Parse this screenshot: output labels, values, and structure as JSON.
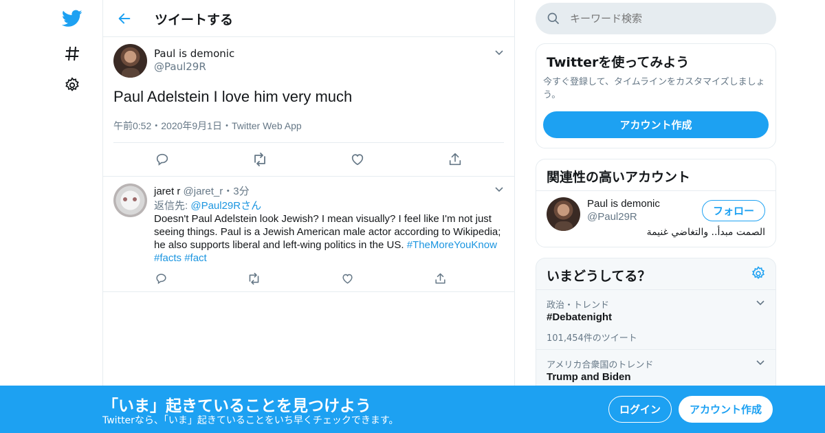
{
  "nav": {
    "icons": [
      "twitter-bird-icon",
      "hashtag-icon",
      "gear-icon"
    ]
  },
  "header": {
    "title": "ツイートする"
  },
  "focused_tweet": {
    "display_name": "Paul is demonic",
    "handle": "@Paul29R",
    "text": "Paul Adelstein I love him very much",
    "time": "午前0:52",
    "date": "2020年9月1日",
    "source": "Twitter Web App",
    "sep": "・"
  },
  "reply_tweet": {
    "display_name": "jaret r",
    "handle": "@jaret_r",
    "time_ago": "3分",
    "sep": "・",
    "reply_to_prefix": "返信先: ",
    "reply_to_handle": "@Paul29R",
    "reply_to_suffix": "さん",
    "body": "Doesn't Paul Adelstein look Jewish? I mean visually? I feel like I'm not just seeing things. Paul is a Jewish American male actor according to Wikipedia; he also supports liberal and left-wing politics in the US.",
    "hashtags": [
      "#TheMoreYouKnow",
      "#facts",
      "#fact"
    ]
  },
  "search": {
    "placeholder": "キーワード検索"
  },
  "signup_card": {
    "title": "Twitterを使ってみよう",
    "description": "今すぐ登録して、タイムラインをカスタマイズしましょう。",
    "button": "アカウント作成"
  },
  "related_card": {
    "title": "関連性の高いアカウント",
    "display_name": "Paul is demonic",
    "handle": "@Paul29R",
    "bio": "الصمت مبدأ.. والتغاضي غنيمة",
    "follow_button": "フォロー"
  },
  "trends_card": {
    "title": "いまどうしてる？",
    "trends": [
      {
        "category": "政治・トレンド",
        "name": "#Debatenight",
        "count": "101,454件のツイート"
      },
      {
        "category": "アメリカ合衆国のトレンド",
        "name": "Trump and Biden"
      }
    ]
  },
  "banner": {
    "title": "「いま」起きていることを見つけよう",
    "subtitle": "Twitterなら、「いま」起きていることをいち早くチェックできます。",
    "login": "ログイン",
    "signup": "アカウント作成"
  },
  "colors": {
    "accent": "#1da1f2",
    "link": "#1b95e0",
    "muted": "#657786",
    "border": "#e6ecf0"
  }
}
